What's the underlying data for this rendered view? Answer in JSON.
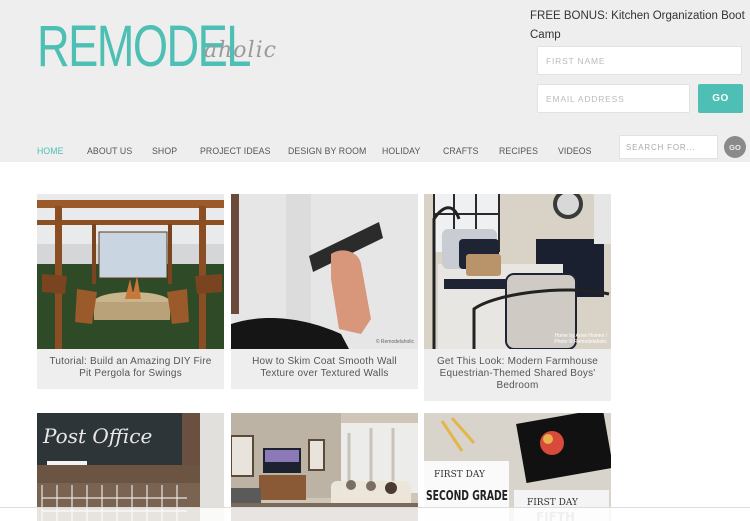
{
  "site": {
    "logo_main": "REMODEL",
    "logo_sub": "aholic",
    "brand_color": "#4ebfb4"
  },
  "optin": {
    "title": "FREE BONUS: Kitchen Organization Boot Camp",
    "first_name_placeholder": "FIRST NAME",
    "email_placeholder": "EMAIL ADDRESS",
    "go_label": "GO"
  },
  "nav": {
    "items": [
      {
        "label": "HOME",
        "active": true
      },
      {
        "label": "ABOUT US"
      },
      {
        "label": "SHOP"
      },
      {
        "label": "PROJECT IDEAS"
      },
      {
        "label": "DESIGN BY ROOM"
      },
      {
        "label": "HOLIDAY"
      },
      {
        "label": "CRAFTS"
      },
      {
        "label": "RECIPES"
      },
      {
        "label": "VIDEOS"
      }
    ],
    "search_placeholder": "SEARCH FOR...",
    "search_go_label": "GO"
  },
  "posts": [
    {
      "caption": "Tutorial: Build an Amazing DIY Fire Pit Pergola for Swings",
      "image": "fire-pit-pergola-render"
    },
    {
      "caption": "How to Skim Coat Smooth Wall Texture over Textured Walls",
      "image": "skim-coat-wall",
      "watermark": "© Remodelaholic"
    },
    {
      "caption": "Get This Look: Modern Farmhouse Equestrian-Themed Shared Boys' Bedroom",
      "image": "farmhouse-bedroom",
      "watermark": "Home by Arive Homes / Photo © Remodelaholic"
    },
    {
      "image": "post-office-chalkboard",
      "chalk_text": "Post Office"
    },
    {
      "image": "living-room"
    },
    {
      "image": "first-day-signs",
      "sign_text_1": "FIRST DAY",
      "sign_text_2": "SECOND GRADE",
      "sign_text_3": "FIFTH"
    }
  ]
}
